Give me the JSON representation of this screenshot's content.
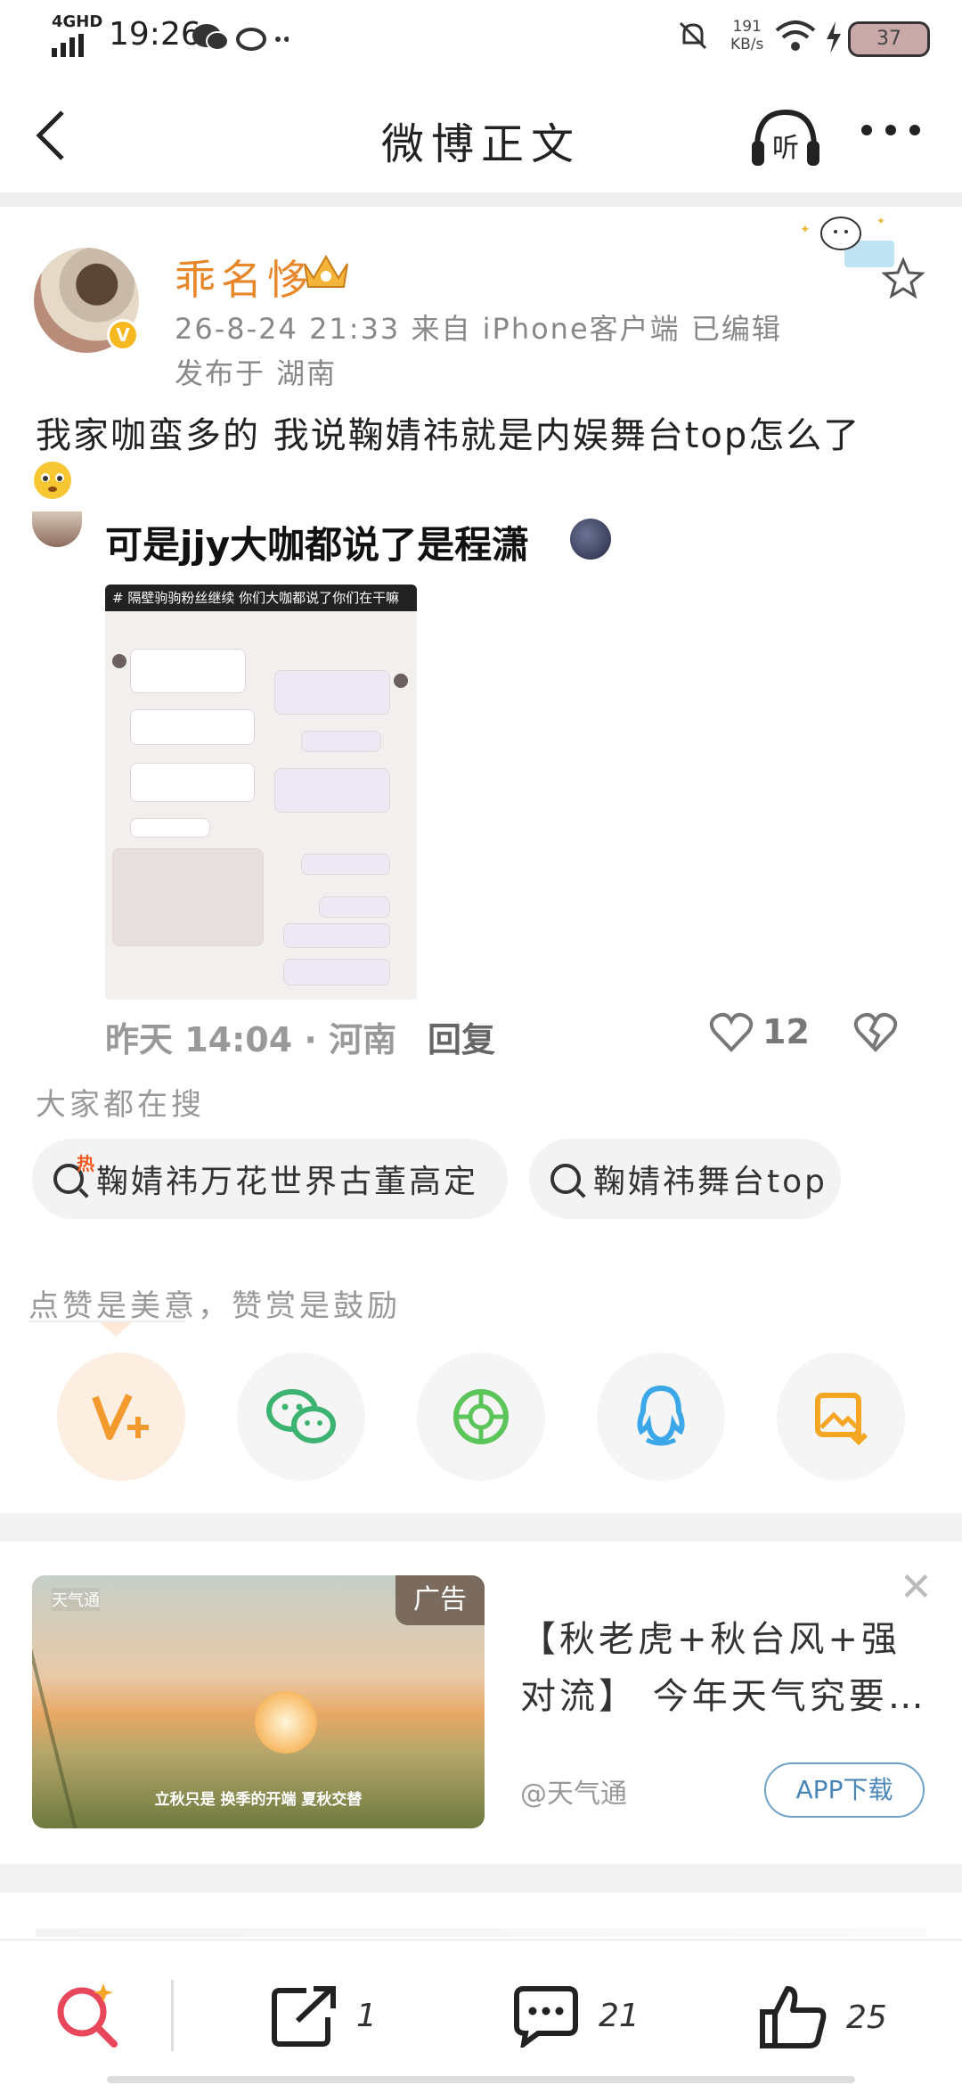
{
  "status_bar": {
    "network": "4GHD",
    "time": "19:26",
    "speed": "191",
    "speed_unit": "KB/s",
    "battery": "37"
  },
  "header": {
    "title": "微博正文",
    "listen_label": "听"
  },
  "post": {
    "author": "乖名恀",
    "meta": "26-8-24 21:33  来自 iPhone客户端  已编辑",
    "location": "发布于 湖南",
    "text": "我家咖蛮多的 我说鞠婧祎就是内娱舞台top怎么了",
    "repost": {
      "text": "可是jjy大咖都说了是程潇",
      "screenshot_caption": "# 隔壁驹驹粉丝继续 你们大咖都说了你们在干嘛",
      "time_location": "昨天 14:04 · 河南",
      "reply_label": "回复",
      "like_count": "12"
    }
  },
  "hot_search": {
    "heading": "大家都在搜",
    "hot_tag": "热",
    "items": [
      "鞠婧祎万花世界古董高定",
      "鞠婧祎舞台top"
    ]
  },
  "reward": {
    "tip": "点赞是美意，赞赏是鼓励",
    "share_targets": [
      "v-plus-icon",
      "wechat-icon",
      "moments-icon",
      "qq-icon",
      "save-image-icon"
    ]
  },
  "ad": {
    "badge": "广告",
    "logo": "天气通",
    "caption": "立秋只是 换季的开端 夏秋交替",
    "title": "【秋老虎+秋台风+强对流】 今年天气究要…",
    "source": "@天气通",
    "button": "APP下载"
  },
  "toolbar": {
    "share_count": "1",
    "comment_count": "21",
    "like_count": "25"
  },
  "colors": {
    "author": "#e8862a",
    "accent_orange": "#f59a23",
    "wechat": "#3cb371",
    "qq": "#3ca7e8"
  }
}
